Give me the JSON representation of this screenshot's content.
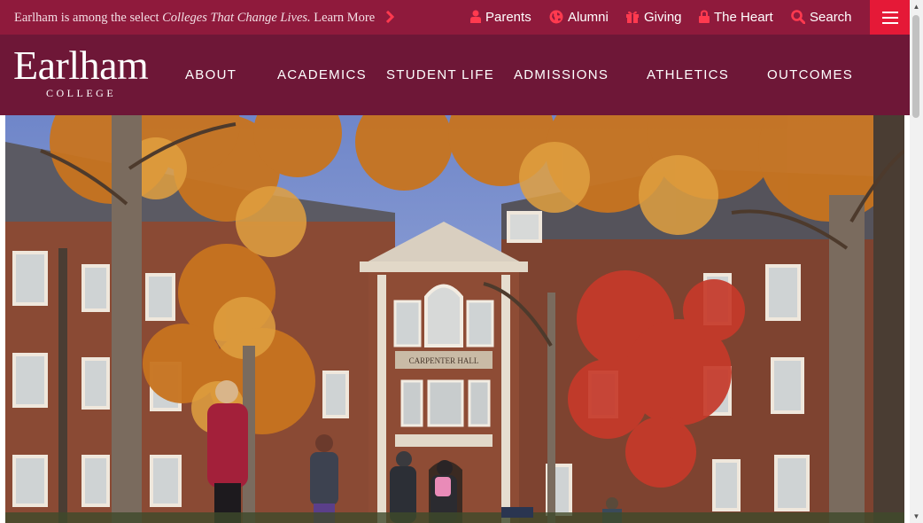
{
  "topbar": {
    "announcement": {
      "prefix": "Earlham is among the select",
      "emphasis": "Colleges That Change Lives.",
      "link": "Learn More"
    },
    "links": [
      {
        "label": "Parents",
        "icon": "person-icon"
      },
      {
        "label": "Alumni",
        "icon": "globe-icon"
      },
      {
        "label": "Giving",
        "icon": "gift-icon"
      },
      {
        "label": "The Heart",
        "icon": "lock-icon"
      },
      {
        "label": "Search",
        "icon": "search-icon"
      }
    ],
    "menu_icon": "hamburger-menu-icon"
  },
  "logo": {
    "wordmark": "Earlham",
    "subtitle": "COLLEGE"
  },
  "nav": {
    "items": [
      "ABOUT",
      "ACADEMICS",
      "STUDENT LIFE",
      "ADMISSIONS",
      "ATHLETICS",
      "OUTCOMES"
    ]
  },
  "hero": {
    "building_sign": "CARPENTER HALL"
  },
  "colors": {
    "topbar": "#8f1a3c",
    "mainbar": "#6e1737",
    "accent": "#e51937",
    "icon_red": "#ff3a4f"
  }
}
